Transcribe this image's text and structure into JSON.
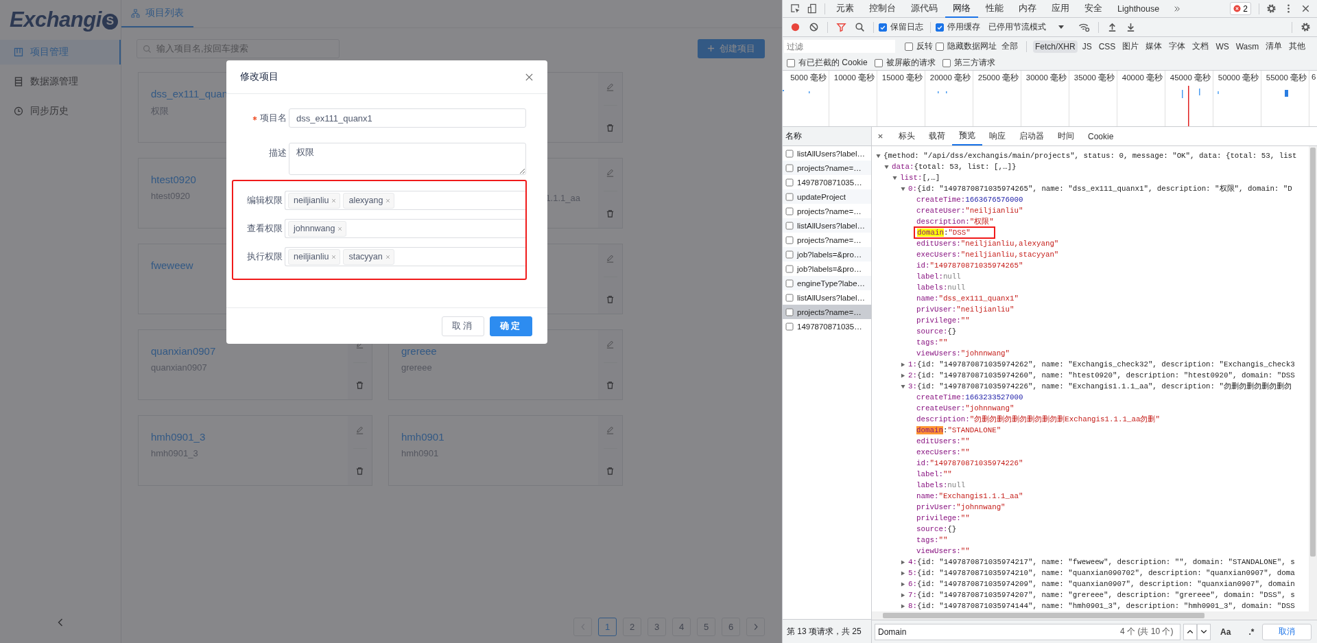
{
  "app": {
    "logo": {
      "text": "Exchangi",
      "badge": "S"
    },
    "sidebar": {
      "items": [
        {
          "label": "项目管理",
          "selected": true
        },
        {
          "label": "数据源管理",
          "selected": false
        },
        {
          "label": "同步历史",
          "selected": false
        }
      ]
    },
    "tabs": [
      {
        "label": "项目列表",
        "selected": true
      }
    ],
    "search": {
      "placeholder": "输入项目名,按回车搜索"
    },
    "create_button": "创建项目",
    "projects": [
      {
        "kind": "left",
        "name": "dss_ex111_quan",
        "description": "权限"
      },
      {
        "kind": "covered"
      },
      {
        "kind": "left",
        "name": "htest0920",
        "description": "htest0920"
      },
      {
        "kind": "covered",
        "description": "1.1.1_aa"
      },
      {
        "kind": "left",
        "name": "fweweew"
      },
      {
        "kind": "covered"
      },
      {
        "kind": "full",
        "name": "quanxian0907",
        "description": "quanxian0907"
      },
      {
        "kind": "full",
        "name": "grereee",
        "description": "grereee"
      },
      {
        "kind": "full",
        "name": "hmh0901_3",
        "description": "hmh0901_3"
      },
      {
        "kind": "full",
        "name": "hmh0901",
        "description": "hmh0901"
      }
    ],
    "pagination": {
      "prev": {
        "disabled": true
      },
      "next": {
        "disabled": false
      },
      "pages": [
        {
          "label": "1",
          "selected": true
        },
        {
          "label": "2",
          "selected": false
        },
        {
          "label": "3",
          "selected": false
        },
        {
          "label": "4",
          "selected": false
        },
        {
          "label": "5",
          "selected": false
        },
        {
          "label": "6",
          "selected": false
        }
      ]
    },
    "modal": {
      "title": "修改项目",
      "fields": [
        {
          "kind": "input",
          "label": "项目名",
          "required": true,
          "value": "dss_ex111_quanx1"
        },
        {
          "kind": "textarea",
          "label": "描述",
          "required": false,
          "value": "权限"
        }
      ],
      "highlight_fields": [
        {
          "label": "编辑权限",
          "tags": [
            "neiljianliu",
            "alexyang"
          ]
        },
        {
          "label": "查看权限",
          "tags": [
            "johnnwang"
          ]
        },
        {
          "label": "执行权限",
          "tags": [
            "neiljianliu",
            "stacyyan"
          ]
        }
      ],
      "buttons": [
        {
          "label": "取消",
          "primary": false
        },
        {
          "label": "确定",
          "primary": true
        }
      ]
    }
  },
  "devtools": {
    "panel_tabs": [
      {
        "label": "元素",
        "selected": false
      },
      {
        "label": "控制台",
        "selected": false
      },
      {
        "label": "源代码",
        "selected": false
      },
      {
        "label": "网络",
        "selected": true
      },
      {
        "label": "性能",
        "selected": false
      },
      {
        "label": "内存",
        "selected": false
      },
      {
        "label": "应用",
        "selected": false
      },
      {
        "label": "安全",
        "selected": false
      },
      {
        "label": "Lighthouse",
        "selected": false
      }
    ],
    "error_count": "2",
    "toolbar": {
      "checks": [
        {
          "label": "保留日志",
          "checked": true
        },
        {
          "label": "停用缓存",
          "checked": true
        }
      ],
      "throttling": "已停用节流模式"
    },
    "filter": {
      "placeholder": "过滤",
      "checks": [
        {
          "label": "反转",
          "checked": false
        },
        {
          "label": "隐藏数据网址",
          "checked": false
        }
      ],
      "types": [
        {
          "label": "全部",
          "selected": false
        },
        {
          "label": "Fetch/XHR",
          "selected": true
        },
        {
          "label": "JS",
          "selected": false
        },
        {
          "label": "CSS",
          "selected": false
        },
        {
          "label": "图片",
          "selected": false
        },
        {
          "label": "媒体",
          "selected": false
        },
        {
          "label": "字体",
          "selected": false
        },
        {
          "label": "文档",
          "selected": false
        },
        {
          "label": "WS",
          "selected": false
        },
        {
          "label": "Wasm",
          "selected": false
        },
        {
          "label": "清单",
          "selected": false
        },
        {
          "label": "其他",
          "selected": false
        }
      ]
    },
    "filter_checks": [
      {
        "label": "有已拦截的 Cookie",
        "checked": false
      },
      {
        "label": "被屏蔽的请求",
        "checked": false
      },
      {
        "label": "第三方请求",
        "checked": false
      }
    ],
    "timeline": {
      "ticks": [
        "5000 毫秒",
        "10000 毫秒",
        "15000 毫秒",
        "20000 毫秒",
        "25000 毫秒",
        "30000 毫秒",
        "35000 毫秒",
        "40000 毫秒",
        "45000 毫秒",
        "50000 毫秒",
        "55000 毫秒",
        "6"
      ]
    },
    "requests": {
      "header": "名称",
      "rows": [
        {
          "name": "listAllUsers?label…",
          "selected": false
        },
        {
          "name": "projects?name=…",
          "selected": false
        },
        {
          "name": "1497870871035…",
          "selected": false
        },
        {
          "name": "updateProject",
          "selected": false
        },
        {
          "name": "projects?name=…",
          "selected": false
        },
        {
          "name": "listAllUsers?label…",
          "selected": false
        },
        {
          "name": "projects?name=…",
          "selected": false
        },
        {
          "name": "job?labels=&pro…",
          "selected": false
        },
        {
          "name": "job?labels=&pro…",
          "selected": false
        },
        {
          "name": "engineType?labe…",
          "selected": false
        },
        {
          "name": "listAllUsers?label…",
          "selected": false
        },
        {
          "name": "projects?name=…",
          "selected": true
        },
        {
          "name": "1497870871035…",
          "selected": false
        }
      ],
      "status": "第 13 项请求，共 25"
    },
    "detail_tabs": [
      {
        "label": "标头",
        "selected": false
      },
      {
        "label": "载荷",
        "selected": false
      },
      {
        "label": "预览",
        "selected": true
      },
      {
        "label": "响应",
        "selected": false
      },
      {
        "label": "启动器",
        "selected": false
      },
      {
        "label": "时间",
        "selected": false
      },
      {
        "label": "Cookie",
        "selected": false
      }
    ],
    "preview": {
      "tree": {
        "summary": "{method: \"/api/dss/exchangis/main/projects\", status: 0, message: \"OK\", data: {total: 53, list",
        "expanded": true,
        "children": [
          {
            "key": "data:",
            "summary": "{total: 53, list: [,…]}",
            "expanded": true,
            "children": [
              {
                "key": "list:",
                "summary": "[,…]",
                "expanded": true,
                "children": [
                  {
                    "key": "0:",
                    "summary": "{id: \"1497870871035974265\", name: \"dss_ex111_quanx1\", description: \"权限\", domain: \"D",
                    "expanded": true,
                    "children": [
                      {
                        "key": "createTime:",
                        "value": "1663676576000",
                        "kind": "number"
                      },
                      {
                        "key": "createUser:",
                        "value": "\"neiljianliu\"",
                        "kind": "string"
                      },
                      {
                        "key": "description:",
                        "value": "\"权限\"",
                        "kind": "string"
                      },
                      {
                        "key": "domain:",
                        "value": "\"DSS\"",
                        "kind": "string",
                        "search_match": true,
                        "current_match": false,
                        "annotated": true
                      },
                      {
                        "key": "editUsers:",
                        "value": "\"neiljianliu,alexyang\"",
                        "kind": "string"
                      },
                      {
                        "key": "execUsers:",
                        "value": "\"neiljianliu,stacyyan\"",
                        "kind": "string"
                      },
                      {
                        "key": "id:",
                        "value": "\"1497870871035974265\"",
                        "kind": "string"
                      },
                      {
                        "key": "label:",
                        "value": "null",
                        "kind": "null"
                      },
                      {
                        "key": "labels:",
                        "value": "null",
                        "kind": "null"
                      },
                      {
                        "key": "name:",
                        "value": "\"dss_ex111_quanx1\"",
                        "kind": "string"
                      },
                      {
                        "key": "privUser:",
                        "value": "\"neiljianliu\"",
                        "kind": "string"
                      },
                      {
                        "key": "privilege:",
                        "value": "\"\"",
                        "kind": "string"
                      },
                      {
                        "key": "source:",
                        "value": "{}",
                        "kind": "object"
                      },
                      {
                        "key": "tags:",
                        "value": "\"\"",
                        "kind": "string"
                      },
                      {
                        "key": "viewUsers:",
                        "value": "\"johnnwang\"",
                        "kind": "string"
                      }
                    ]
                  },
                  {
                    "key": "1:",
                    "summary": "{id: \"1497870871035974262\", name: \"Exchangis_check32\", description: \"Exchangis_check3",
                    "expanded": false
                  },
                  {
                    "key": "2:",
                    "summary": "{id: \"1497870871035974260\", name: \"htest0920\", description: \"htest0920\", domain: \"DSS",
                    "expanded": false
                  },
                  {
                    "key": "3:",
                    "summary": "{id: \"1497870871035974226\", name: \"Exchangis1.1.1_aa\", description: \"勿删勿删勿删勿删勿",
                    "expanded": true,
                    "children": [
                      {
                        "key": "createTime:",
                        "value": "1663233527000",
                        "kind": "number"
                      },
                      {
                        "key": "createUser:",
                        "value": "\"johnnwang\"",
                        "kind": "string"
                      },
                      {
                        "key": "description:",
                        "value": "\"勿删勿删勿删勿删勿删勿删Exchangis1.1.1_aa勿删\"",
                        "kind": "string"
                      },
                      {
                        "key": "domain:",
                        "value": "\"STANDALONE\"",
                        "kind": "string",
                        "search_match": true,
                        "current_match": true
                      },
                      {
                        "key": "editUsers:",
                        "value": "\"\"",
                        "kind": "string"
                      },
                      {
                        "key": "execUsers:",
                        "value": "\"\"",
                        "kind": "string"
                      },
                      {
                        "key": "id:",
                        "value": "\"1497870871035974226\"",
                        "kind": "string"
                      },
                      {
                        "key": "label:",
                        "value": "\"\"",
                        "kind": "string"
                      },
                      {
                        "key": "labels:",
                        "value": "null",
                        "kind": "null"
                      },
                      {
                        "key": "name:",
                        "value": "\"Exchangis1.1.1_aa\"",
                        "kind": "string"
                      },
                      {
                        "key": "privUser:",
                        "value": "\"johnnwang\"",
                        "kind": "string"
                      },
                      {
                        "key": "privilege:",
                        "value": "\"\"",
                        "kind": "string"
                      },
                      {
                        "key": "source:",
                        "value": "{}",
                        "kind": "object"
                      },
                      {
                        "key": "tags:",
                        "value": "\"\"",
                        "kind": "string"
                      },
                      {
                        "key": "viewUsers:",
                        "value": "\"\"",
                        "kind": "string"
                      }
                    ]
                  },
                  {
                    "key": "4:",
                    "summary": "{id: \"1497870871035974217\", name: \"fweweew\", description: \"\", domain: \"STANDALONE\", s",
                    "expanded": false
                  },
                  {
                    "key": "5:",
                    "summary": "{id: \"1497870871035974210\", name: \"quanxian090702\", description: \"quanxian0907\", doma",
                    "expanded": false
                  },
                  {
                    "key": "6:",
                    "summary": "{id: \"1497870871035974209\", name: \"quanxian0907\", description: \"quanxian0907\", domain",
                    "expanded": false
                  },
                  {
                    "key": "7:",
                    "summary": "{id: \"1497870871035974207\", name: \"grereee\", description: \"grereee\", domain: \"DSS\", s",
                    "expanded": false
                  },
                  {
                    "key": "8:",
                    "summary": "{id: \"1497870871035974144\", name: \"hmh0901_3\", description: \"hmh0901_3\", domain: \"DSS",
                    "expanded": false
                  }
                ]
              }
            ]
          }
        ]
      }
    },
    "find": {
      "value": "Domain",
      "count": "4 个 (共 10 个)",
      "match_case": "Aa",
      "regex": ".*",
      "cancel": "取消"
    }
  }
}
